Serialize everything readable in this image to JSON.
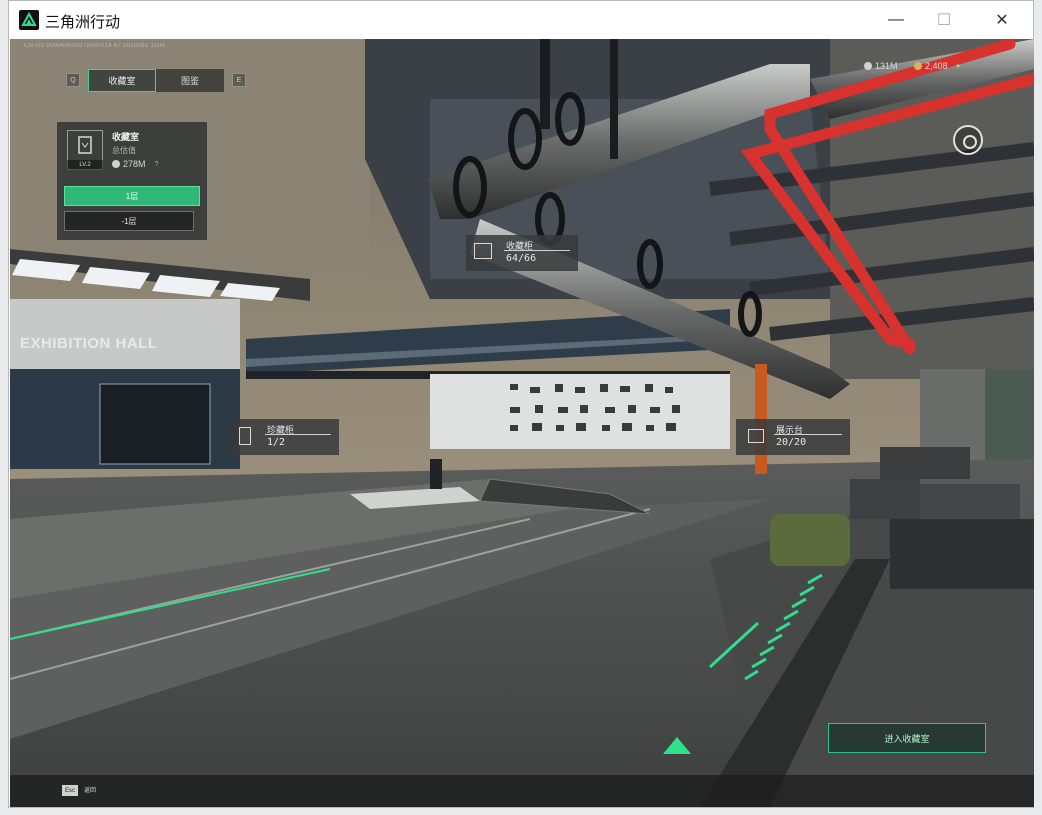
{
  "window": {
    "title": "三角洲行动",
    "minimize_glyph": "—",
    "maximize_glyph": "☐",
    "close_glyph": "✕"
  },
  "game": {
    "debug_text": "CN 0/0 000060530279580014 87 2020061 1504",
    "tabs": {
      "left_key": "Q",
      "items": [
        {
          "label": "收藏室",
          "active": true
        },
        {
          "label": "图鉴",
          "active": false
        }
      ],
      "right_key": "E"
    },
    "currency": {
      "silver": "131M",
      "gold": "2,408",
      "gold_plus": "+"
    },
    "room_panel": {
      "title": "收藏室",
      "subtitle": "总估值",
      "value": "278M",
      "level": "LV.2",
      "help_glyph": "?",
      "primary_button": "1层",
      "secondary_button": "-1层"
    },
    "scene_text": "EXHIBITION HALL",
    "markers": [
      {
        "name": "收藏柜",
        "count": "64/66"
      },
      {
        "name": "珍藏柜",
        "count": "1/2"
      },
      {
        "name": "展示台",
        "count": "20/20"
      }
    ],
    "enter_button": "进入收藏室",
    "bottom_bar": {
      "key": "Esc",
      "label": "返回"
    },
    "colors": {
      "accent": "#2fe08a",
      "pipe_red": "#d8322e"
    }
  }
}
